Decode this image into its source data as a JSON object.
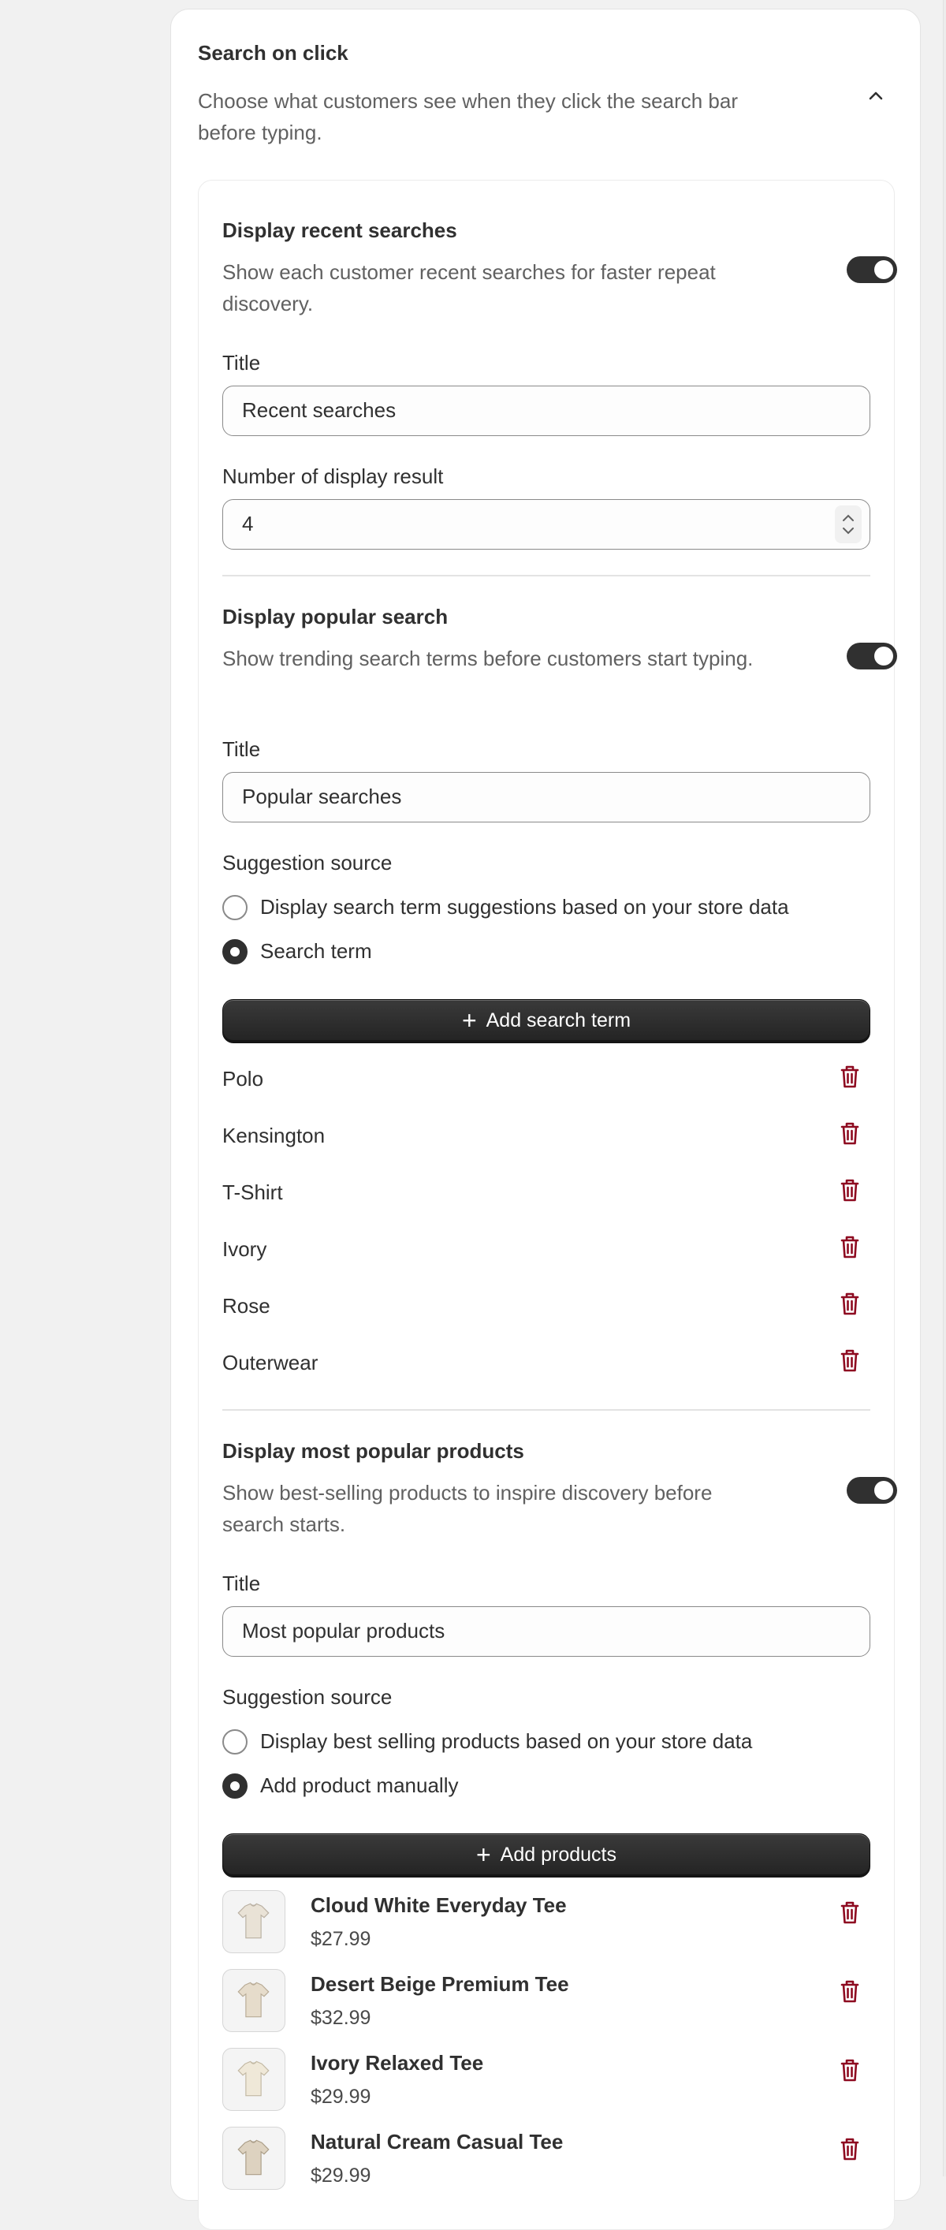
{
  "section": {
    "title": "Search on click",
    "description": "Choose what customers see when they click the search bar before typing."
  },
  "recent": {
    "heading": "Display recent searches",
    "description": "Show each customer recent searches for faster repeat discovery.",
    "toggle_on": true,
    "title_label": "Title",
    "title_value": "Recent searches",
    "count_label": "Number of display result",
    "count_value": "4"
  },
  "popular_search": {
    "heading": "Display popular search",
    "description": "Show trending search terms before customers start typing.",
    "toggle_on": true,
    "title_label": "Title",
    "title_value": "Popular searches",
    "source_label": "Suggestion source",
    "option_store": "Display search term suggestions based on your store data",
    "option_manual": "Search term",
    "selected": "Search term",
    "add_button": "Add search term",
    "terms": [
      "Polo",
      "Kensington",
      "T-Shirt",
      "Ivory",
      "Rose",
      "Outerwear"
    ]
  },
  "popular_products": {
    "heading": "Display most popular products",
    "description": "Show best-selling products to inspire discovery before search starts.",
    "toggle_on": true,
    "title_label": "Title",
    "title_value": "Most popular products",
    "source_label": "Suggestion source",
    "option_store": "Display best selling products based on your store data",
    "option_manual": "Add product manually",
    "selected": "Add product manually",
    "add_button": "Add products",
    "products": [
      {
        "name": "Cloud White Everyday Tee",
        "price": "$27.99"
      },
      {
        "name": "Desert Beige Premium Tee",
        "price": "$32.99"
      },
      {
        "name": "Ivory Relaxed Tee",
        "price": "$29.99"
      },
      {
        "name": "Natural Cream Casual Tee",
        "price": "$29.99"
      }
    ]
  },
  "icons": {
    "collapse": "chevron-up-icon",
    "delete": "trash-icon",
    "add": "plus-icon",
    "product": "t-shirt-thumbnail"
  },
  "colors": {
    "accent_dark": "#303030",
    "delete_red": "#8e0b21",
    "muted_text": "#616161"
  }
}
